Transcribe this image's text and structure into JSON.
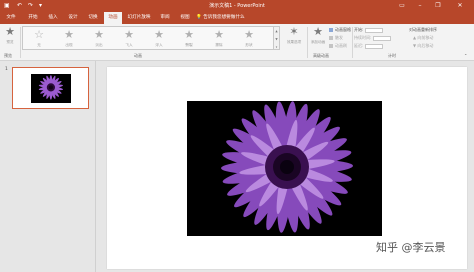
{
  "window": {
    "title": "演示文稿1 - PowerPoint",
    "quick_access": {
      "save_icon": "save-icon",
      "undo_icon": "undo-icon",
      "redo_icon": "redo-icon"
    },
    "controls": {
      "ribbon_options": "ribbon-display-options-icon",
      "minimize": "–",
      "restore": "❐",
      "close": "✕"
    }
  },
  "tabs": [
    {
      "label": "文件"
    },
    {
      "label": "开始"
    },
    {
      "label": "插入"
    },
    {
      "label": "设计"
    },
    {
      "label": "切换"
    },
    {
      "label": "动画"
    },
    {
      "label": "幻灯片放映"
    },
    {
      "label": "审阅"
    },
    {
      "label": "视图"
    }
  ],
  "active_tab": "动画",
  "tell_me": {
    "placeholder": "告诉我您想要做什么"
  },
  "ribbon": {
    "preview": {
      "label": "预览",
      "group": "预览"
    },
    "gallery": {
      "items": [
        {
          "label": "无"
        },
        {
          "label": "出现"
        },
        {
          "label": "淡出"
        },
        {
          "label": "飞入"
        },
        {
          "label": "浮入"
        },
        {
          "label": "劈裂"
        },
        {
          "label": "擦除"
        },
        {
          "label": "形状"
        }
      ],
      "group": "动画"
    },
    "effect_options": {
      "label": "效果选项"
    },
    "add_animation": {
      "label": "添加动画"
    },
    "advanced": {
      "items": [
        {
          "label": "动画窗格"
        },
        {
          "label": "触发"
        },
        {
          "label": "动画刷"
        }
      ],
      "group": "高级动画"
    },
    "timing": {
      "start": "开始:",
      "duration": "持续时间:",
      "delay": "延迟:",
      "reorder": "对动画重新排序",
      "move_earlier": "向前移动",
      "move_later": "向后移动",
      "group": "计时"
    }
  },
  "slides": [
    {
      "number": "1"
    }
  ],
  "watermark": "知乎 @李云景",
  "colors": {
    "accent": "#b7472a",
    "ribbon": "#f3f3f3",
    "thumb_border": "#d6633e"
  }
}
